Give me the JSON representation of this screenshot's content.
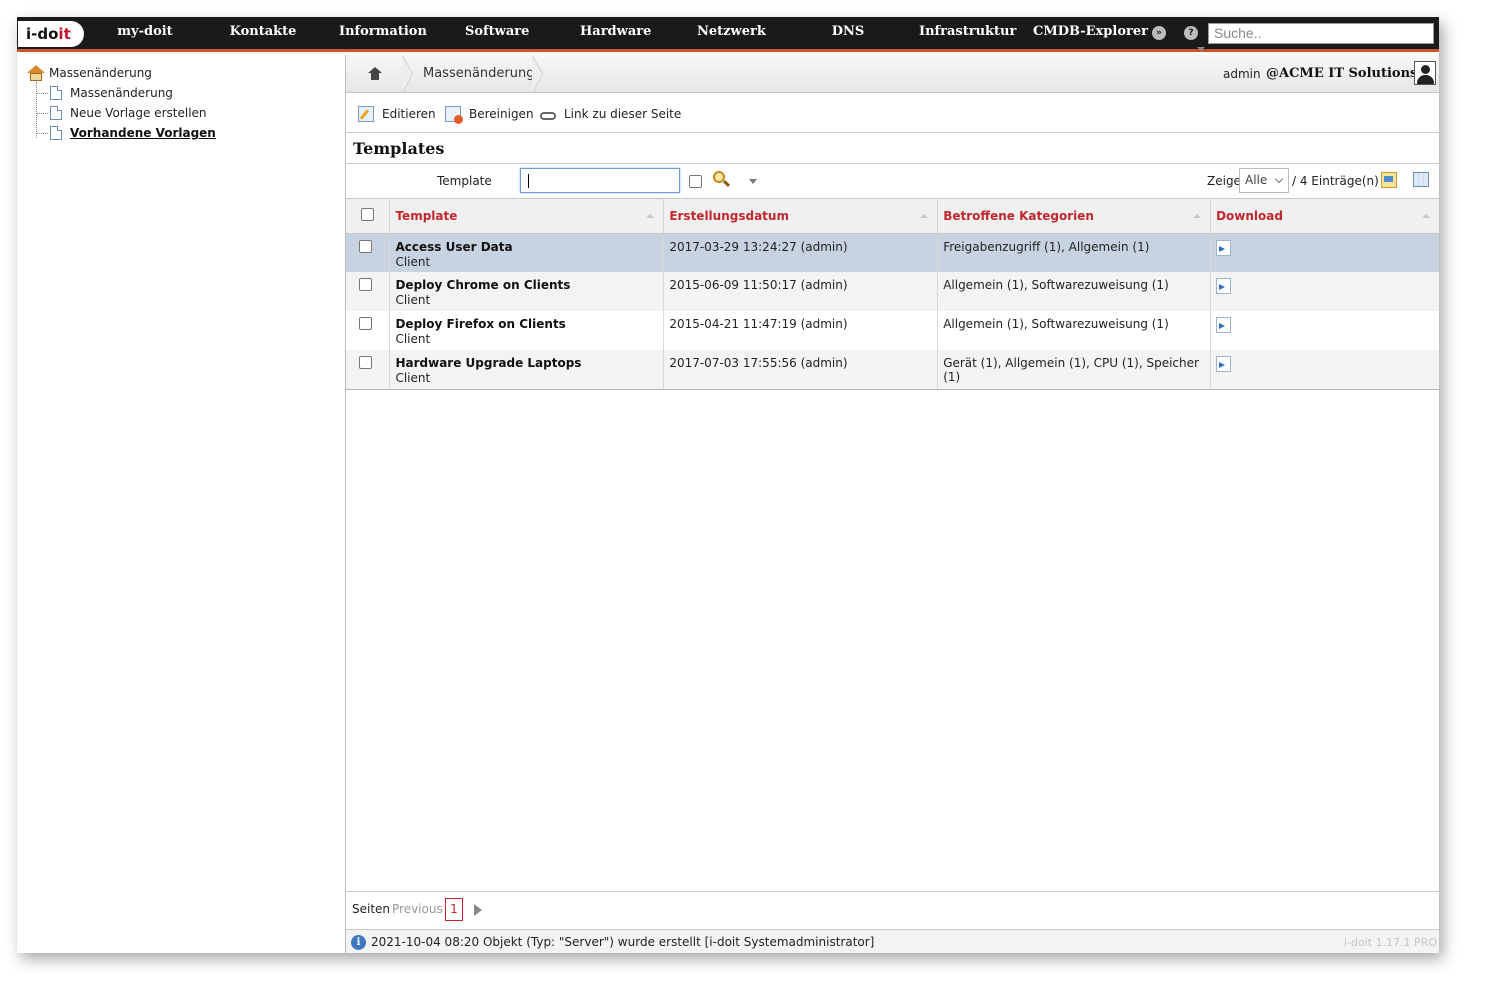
{
  "brand": {
    "logo_text_dark": "i-do",
    "logo_text_red": "it"
  },
  "nav": {
    "items": [
      "my-doit",
      "Kontakte",
      "Information",
      "Software",
      "Hardware",
      "Netzwerk",
      "DNS",
      "Infrastruktur",
      "CMDB-Explorer"
    ],
    "search_placeholder": "Suche.."
  },
  "tree": {
    "root": "Massenänderung",
    "items": [
      {
        "label": "Massenänderung"
      },
      {
        "label": "Neue Vorlage erstellen"
      },
      {
        "label": "Vorhandene Vorlagen"
      }
    ]
  },
  "breadcrumb": {
    "current": "Massenänderung"
  },
  "user": {
    "name": "admin",
    "org": "@ACME IT Solutions"
  },
  "toolbar": {
    "edit": "Editieren",
    "clean": "Bereinigen",
    "link": "Link zu dieser Seite"
  },
  "section": {
    "title": "Templates"
  },
  "filter": {
    "label": "Template",
    "value": "",
    "show_label": "Zeige",
    "show_value": "Alle",
    "entries": "/ 4 Einträge(n)"
  },
  "table": {
    "headers": [
      "Template",
      "Erstellungsdatum",
      "Betroffene Kategorien",
      "Download"
    ],
    "rows": [
      {
        "name": "Access User Data",
        "type": "Client",
        "created": "2017-03-29 13:24:27 (admin)",
        "categories": "Freigabenzugriff (1), Allgemein (1)"
      },
      {
        "name": "Deploy Chrome on Clients",
        "type": "Client",
        "created": "2015-06-09 11:50:17 (admin)",
        "categories": "Allgemein (1), Softwarezuweisung (1)"
      },
      {
        "name": "Deploy Firefox on Clients",
        "type": "Client",
        "created": "2015-04-21 11:47:19 (admin)",
        "categories": "Allgemein (1), Softwarezuweisung (1)"
      },
      {
        "name": "Hardware Upgrade Laptops",
        "type": "Client",
        "created": "2017-07-03 17:55:56 (admin)",
        "categories": "Gerät (1), Allgemein (1), CPU (1), Speicher (1)"
      }
    ]
  },
  "pager": {
    "label": "Seiten",
    "prev": "Previous",
    "current_page": "1"
  },
  "status": {
    "message": "2021-10-04 08:20 Objekt (Typ: \"Server\") wurde erstellt [i-doit Systemadministrator]",
    "version": "i-doit 1.17.1 PRO"
  },
  "colors": {
    "accent": "#c8572b",
    "header_red": "#c1272d",
    "selected_row": "#c7d3e1",
    "nav_bg": "#1a1a1a"
  }
}
